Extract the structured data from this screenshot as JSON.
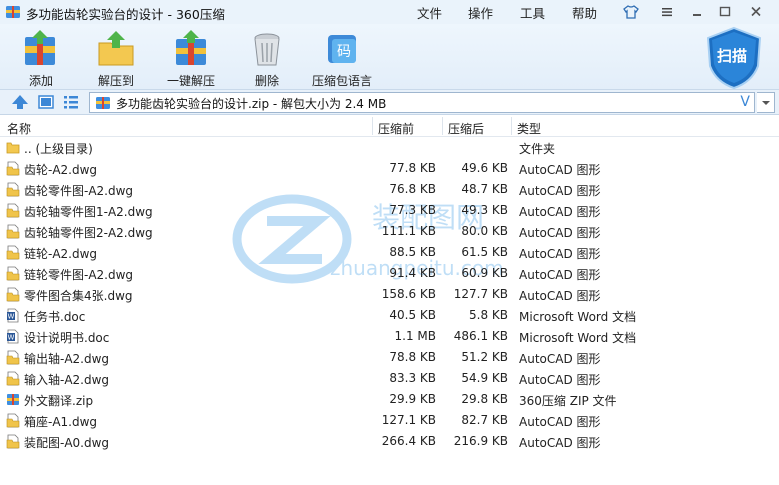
{
  "window": {
    "title": "多功能齿轮实验台的设计 - 360压缩",
    "menus": [
      "文件",
      "操作",
      "工具",
      "帮助"
    ]
  },
  "toolbar": {
    "add_label": "添加",
    "extract_to_label": "解压到",
    "one_click_extract_label": "一键解压",
    "delete_label": "删除",
    "language_label": "压缩包语言",
    "language_badge": "码",
    "scan_label": "扫描"
  },
  "address": {
    "text": "多功能齿轮实验台的设计.zip - 解包大小为 2.4 MB",
    "dropdown_glyph": "V"
  },
  "columns": {
    "name": "名称",
    "compressed": "压缩前",
    "original": "压缩后",
    "type": "类型"
  },
  "files": [
    {
      "name": ".. (上级目录)",
      "compressed": "",
      "original": "",
      "type": "文件夹",
      "icon": "folder-icon"
    },
    {
      "name": "齿轮-A2.dwg",
      "compressed": "77.8 KB",
      "original": "49.6 KB",
      "type": "AutoCAD 图形",
      "icon": "dwg-file-icon"
    },
    {
      "name": "齿轮零件图-A2.dwg",
      "compressed": "76.8 KB",
      "original": "48.7 KB",
      "type": "AutoCAD 图形",
      "icon": "dwg-file-icon"
    },
    {
      "name": "齿轮轴零件图1-A2.dwg",
      "compressed": "77.3 KB",
      "original": "49.3 KB",
      "type": "AutoCAD 图形",
      "icon": "dwg-file-icon"
    },
    {
      "name": "齿轮轴零件图2-A2.dwg",
      "compressed": "111.1 KB",
      "original": "80.0 KB",
      "type": "AutoCAD 图形",
      "icon": "dwg-file-icon"
    },
    {
      "name": "链轮-A2.dwg",
      "compressed": "88.5 KB",
      "original": "61.5 KB",
      "type": "AutoCAD 图形",
      "icon": "dwg-file-icon"
    },
    {
      "name": "链轮零件图-A2.dwg",
      "compressed": "91.4 KB",
      "original": "60.9 KB",
      "type": "AutoCAD 图形",
      "icon": "dwg-file-icon"
    },
    {
      "name": "零件图合集4张.dwg",
      "compressed": "158.6 KB",
      "original": "127.7 KB",
      "type": "AutoCAD 图形",
      "icon": "dwg-file-icon"
    },
    {
      "name": "任务书.doc",
      "compressed": "40.5 KB",
      "original": "5.8 KB",
      "type": "Microsoft Word 文档",
      "icon": "word-file-icon"
    },
    {
      "name": "设计说明书.doc",
      "compressed": "1.1 MB",
      "original": "486.1 KB",
      "type": "Microsoft Word 文档",
      "icon": "word-file-icon"
    },
    {
      "name": "输出轴-A2.dwg",
      "compressed": "78.8 KB",
      "original": "51.2 KB",
      "type": "AutoCAD 图形",
      "icon": "dwg-file-icon"
    },
    {
      "name": "输入轴-A2.dwg",
      "compressed": "83.3 KB",
      "original": "54.9 KB",
      "type": "AutoCAD 图形",
      "icon": "dwg-file-icon"
    },
    {
      "name": "外文翻译.zip",
      "compressed": "29.9 KB",
      "original": "29.8 KB",
      "type": "360压缩 ZIP 文件",
      "icon": "zip-file-icon"
    },
    {
      "name": "箱座-A1.dwg",
      "compressed": "127.1 KB",
      "original": "82.7 KB",
      "type": "AutoCAD 图形",
      "icon": "dwg-file-icon"
    },
    {
      "name": "装配图-A0.dwg",
      "compressed": "266.4 KB",
      "original": "216.9 KB",
      "type": "AutoCAD 图形",
      "icon": "dwg-file-icon"
    }
  ],
  "watermark": {
    "text_cn": "装配图网",
    "text_url": "zhuangpeitu.com"
  },
  "colors": {
    "accent_blue": "#2f86d8",
    "toolbar_bg": "#e3eef9",
    "scan_badge": "#1d6fc2"
  }
}
